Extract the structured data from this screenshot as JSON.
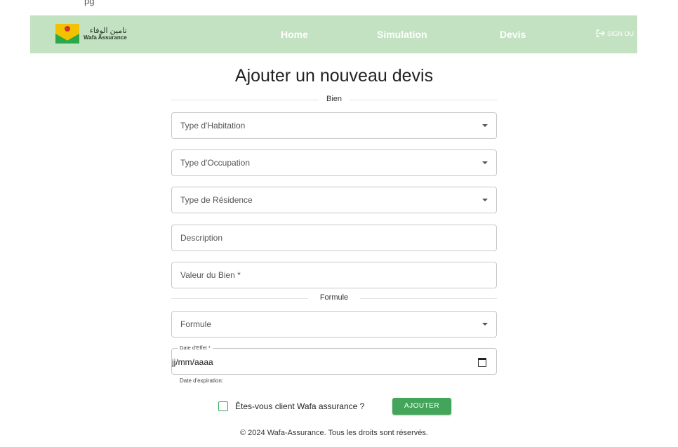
{
  "top_crop_text": "pg",
  "brand": {
    "name_ar": "تامين الوفاء",
    "name_en": "Wafa Assurance"
  },
  "nav": {
    "items": [
      {
        "label": "Home"
      },
      {
        "label": "Simulation"
      },
      {
        "label": "Devis"
      }
    ],
    "signout_label": "SIGN OU"
  },
  "page_title": "Ajouter un nouveau devis",
  "sections": {
    "bien": "Bien",
    "formule": "Formule"
  },
  "fields": {
    "type_habitation": "Type d'Habitation",
    "type_occupation": "Type d'Occupation",
    "type_residence": "Type de Résidence",
    "description": "Description",
    "valeur_bien": "Valeur du Bien *",
    "formule": "Formule",
    "date_effet_label": "Date d'Effet *",
    "date_effet_value": "jj/mm/aaaa",
    "date_expiration_label": "Date d'expiration:"
  },
  "client_checkbox_label": "Êtes-vous client Wafa assurance ?",
  "submit_label": "AJOUTER",
  "footer": "© 2024 Wafa-Assurance. Tous les droits sont réservés.",
  "colors": {
    "navbar": "#c3e2c2",
    "accent_green": "#43a55a",
    "nav_text": "#ffffff"
  },
  "icons": {
    "signout": "logout-arrow-icon",
    "dropdown": "caret-down-icon",
    "calendar": "calendar-icon"
  }
}
